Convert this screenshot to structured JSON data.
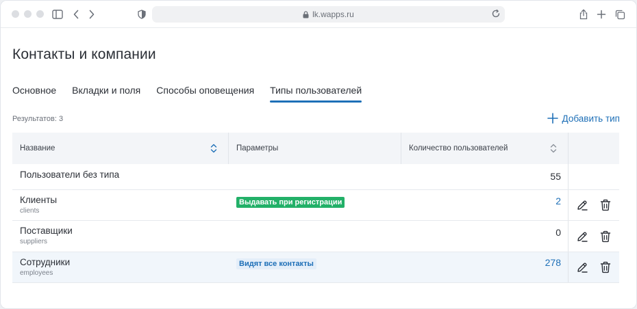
{
  "browser": {
    "url": "lk.wapps.ru"
  },
  "page": {
    "title": "Контакты и компании"
  },
  "tabs": [
    {
      "label": "Основное",
      "active": false
    },
    {
      "label": "Вкладки и поля",
      "active": false
    },
    {
      "label": "Способы оповещения",
      "active": false
    },
    {
      "label": "Типы пользователей",
      "active": true
    }
  ],
  "toolbar": {
    "results": "Результатов: 3",
    "add_label": "Добавить тип"
  },
  "table": {
    "headers": {
      "name": "Название",
      "params": "Параметры",
      "count": "Количество пользователей"
    },
    "rows": [
      {
        "name": "Пользователи без типа",
        "code": "",
        "badge": "",
        "count": "55",
        "count_style": "plain",
        "actions": false
      },
      {
        "name": "Клиенты",
        "code": "clients",
        "badge": "Выдавать при регистрации",
        "badge_style": "green",
        "count": "2",
        "count_style": "link",
        "actions": true
      },
      {
        "name": "Поставщики",
        "code": "suppliers",
        "badge": "",
        "count": "0",
        "count_style": "plain",
        "actions": true
      },
      {
        "name": "Сотрудники",
        "code": "employees",
        "badge": "Видят все контакты",
        "badge_style": "blue",
        "count": "278",
        "count_style": "link",
        "actions": true
      }
    ]
  },
  "colors": {
    "accent": "#1d6fb7",
    "badge_green": "#22b068",
    "badge_blue_bg": "#e4eef9",
    "row_highlight": "#f1f6fb"
  },
  "icons": {
    "sort": "sort-icon",
    "edit": "pencil-icon",
    "delete": "trash-icon",
    "add": "plus-icon"
  }
}
